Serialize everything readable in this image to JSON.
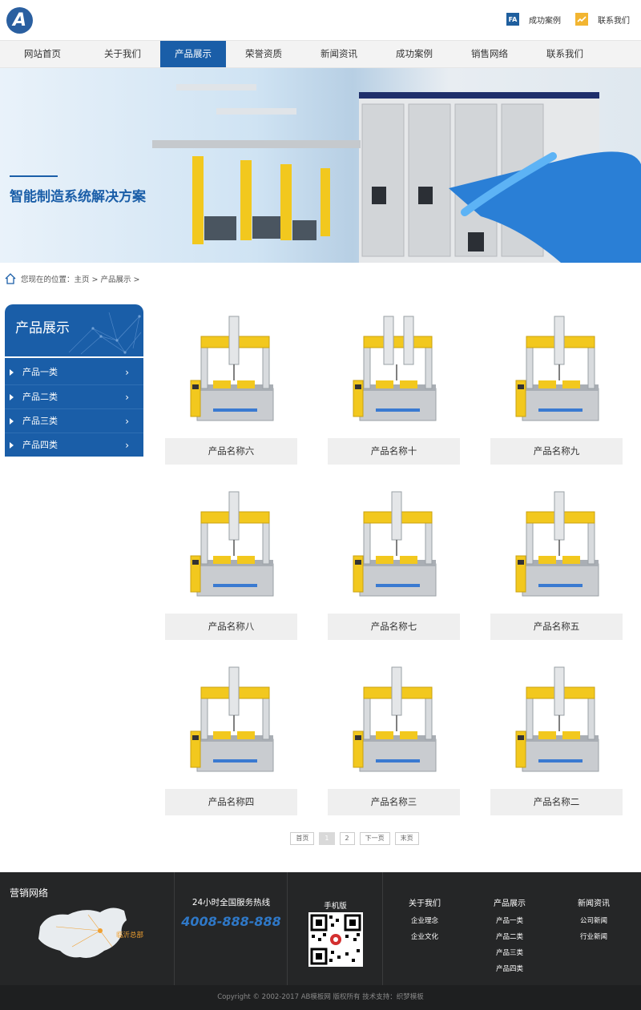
{
  "brand": {
    "logo_letter": "A"
  },
  "top_links": [
    {
      "icon": "fa-badge-icon",
      "icon_text": "FA",
      "label": "成功案例"
    },
    {
      "icon": "trend-chart-icon",
      "icon_text": "",
      "label": "联系我们"
    }
  ],
  "nav": [
    "网站首页",
    "关于我们",
    "产品展示",
    "荣誉资质",
    "新闻资讯",
    "成功案例",
    "销售网络",
    "联系我们"
  ],
  "nav_active": "产品展示",
  "banner": {
    "slogan": "智能制造系统解决方案"
  },
  "breadcrumb": {
    "text": "您现在的位置：主页 > 产品展示 >"
  },
  "sidebar": {
    "title": "产品展示",
    "items": [
      "产品一类",
      "产品二类",
      "产品三类",
      "产品四类"
    ]
  },
  "products": [
    "产品名称六",
    "产品名称十",
    "产品名称九",
    "产品名称八",
    "产品名称七",
    "产品名称五",
    "产品名称四",
    "产品名称三",
    "产品名称二"
  ],
  "pager": {
    "first": "首页",
    "pages": [
      "1",
      "2"
    ],
    "current": "1",
    "next": "下一页",
    "last": "末页"
  },
  "footer": {
    "marketing": {
      "title": "营销网络",
      "hq_label": "临沂总部"
    },
    "hotline": {
      "title": "24小时全国服务热线",
      "number": "4008-888-888"
    },
    "mobile": {
      "title": "手机版"
    },
    "columns": [
      {
        "title": "关于我们",
        "items": [
          "企业理念",
          "企业文化"
        ]
      },
      {
        "title": "产品展示",
        "items": [
          "产品一类",
          "产品二类",
          "产品三类",
          "产品四类"
        ]
      },
      {
        "title": "新闻资讯",
        "items": [
          "公司新闻",
          "行业新闻"
        ]
      }
    ],
    "copyright": "Copyright © 2002-2017 AB模板网 版权所有 技术支持：织梦模板"
  },
  "colors": {
    "primary": "#1a5ea8",
    "hotline": "#2f78c7",
    "footer_bg": "#252627",
    "accent_yellow": "#f2c81e"
  }
}
